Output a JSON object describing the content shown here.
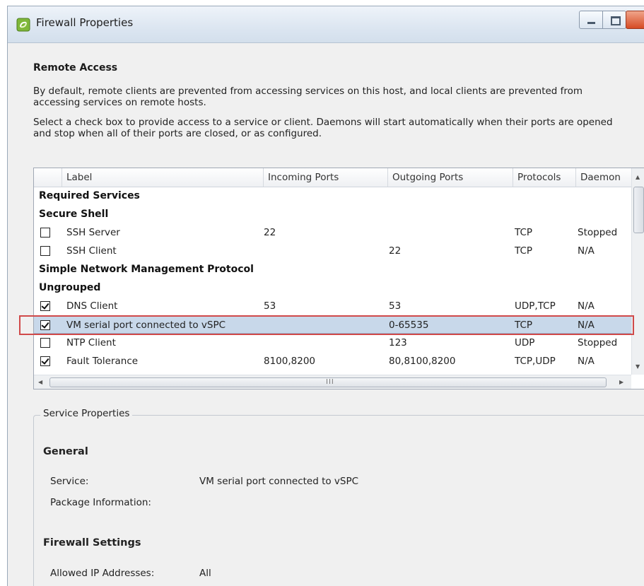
{
  "window": {
    "title": "Firewall Properties"
  },
  "remote_access": {
    "title": "Remote Access",
    "description1": "By default, remote clients are prevented from accessing services on this host, and local clients are prevented from accessing services on remote hosts.",
    "description2": "Select a check box to provide access to a service or client. Daemons will start automatically when their ports are opened and stop when all of their ports are closed, or as configured."
  },
  "grid": {
    "columns": [
      "Label",
      "Incoming Ports",
      "Outgoing Ports",
      "Protocols",
      "Daemon"
    ],
    "rows": [
      {
        "type": "group",
        "label": "Required Services"
      },
      {
        "type": "group",
        "label": "Secure Shell"
      },
      {
        "type": "item",
        "checked": false,
        "label": "SSH Server",
        "incoming": "22",
        "outgoing": "",
        "protocols": "TCP",
        "daemon": "Stopped"
      },
      {
        "type": "item",
        "checked": false,
        "label": "SSH Client",
        "incoming": "",
        "outgoing": "22",
        "protocols": "TCP",
        "daemon": "N/A"
      },
      {
        "type": "group",
        "label": "Simple Network Management Protocol"
      },
      {
        "type": "group",
        "label": "Ungrouped"
      },
      {
        "type": "item",
        "checked": true,
        "label": "DNS Client",
        "incoming": "53",
        "outgoing": "53",
        "protocols": "UDP,TCP",
        "daemon": "N/A"
      },
      {
        "type": "item",
        "checked": true,
        "selected": true,
        "label": "VM serial port connected to vSPC",
        "incoming": "",
        "outgoing": "0-65535",
        "protocols": "TCP",
        "daemon": "N/A"
      },
      {
        "type": "item",
        "checked": false,
        "label": "NTP Client",
        "incoming": "",
        "outgoing": "123",
        "protocols": "UDP",
        "daemon": "Stopped"
      },
      {
        "type": "item",
        "checked": true,
        "label": "Fault Tolerance",
        "incoming": "8100,8200",
        "outgoing": "80,8100,8200",
        "protocols": "TCP,UDP",
        "daemon": "N/A"
      }
    ],
    "scroll_grip": "III"
  },
  "service_properties": {
    "legend": "Service Properties",
    "general_title": "General",
    "service_label": "Service:",
    "service_value": "VM serial port connected to vSPC",
    "package_label": "Package Information:",
    "firewall_title": "Firewall Settings",
    "allowed_ip_label": "Allowed IP Addresses:",
    "allowed_ip_value": "All"
  },
  "colors": {
    "selection": "#c8d8ea",
    "highlight_border": "#d04a4a"
  },
  "icons": {
    "app": "vsphere-firewall-icon"
  }
}
